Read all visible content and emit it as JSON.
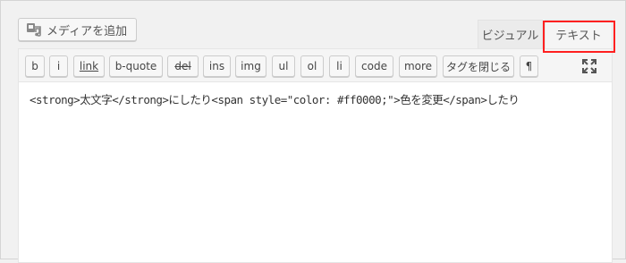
{
  "toolbar": {
    "add_media_label": "メディアを追加"
  },
  "tabs": {
    "visual": "ビジュアル",
    "text": "テキスト"
  },
  "quicktags": [
    {
      "label": "b"
    },
    {
      "label": "i"
    },
    {
      "label": "link"
    },
    {
      "label": "b-quote"
    },
    {
      "label": "del"
    },
    {
      "label": "ins"
    },
    {
      "label": "img"
    },
    {
      "label": "ul"
    },
    {
      "label": "ol"
    },
    {
      "label": "li"
    },
    {
      "label": "code"
    },
    {
      "label": "more"
    },
    {
      "label": "タグを閉じる"
    },
    {
      "label": "¶"
    }
  ],
  "editor": {
    "content": "<strong>太文字</strong>にしたり<span style=\"color: #ff0000;\">色を変更</span>したり"
  },
  "colors": {
    "highlight": "#ff2020",
    "background": "#f1f1f1",
    "editor_bg": "#ffffff"
  }
}
